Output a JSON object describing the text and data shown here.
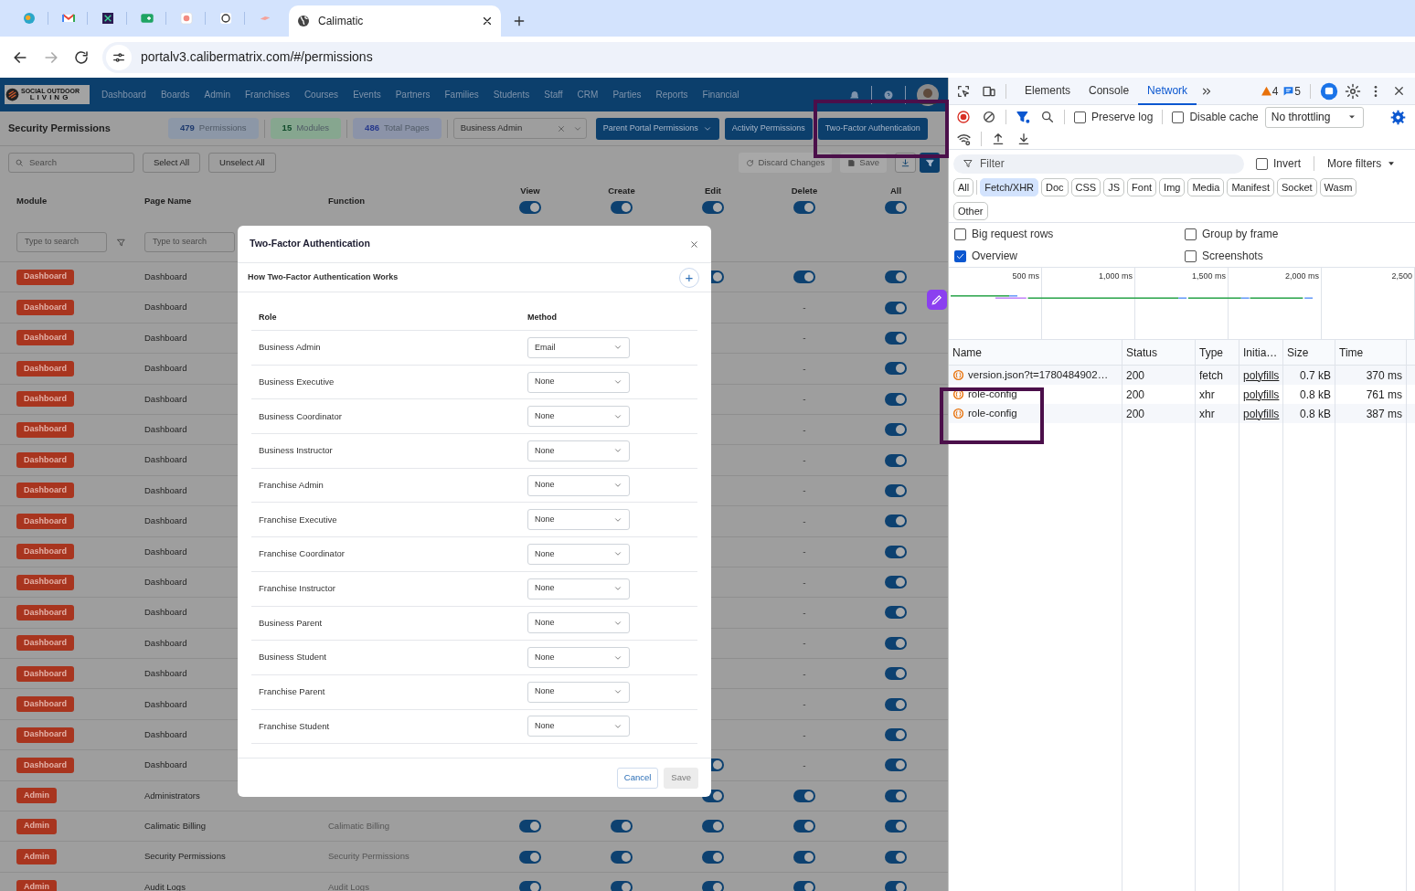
{
  "browser": {
    "active_tab": {
      "title": "Calimatic"
    },
    "url": "portalv3.calibermatrix.com/#/permissions",
    "forward_disabled": true
  },
  "app": {
    "logo": [
      "SOCIAL OUTDOOR",
      "LIVING"
    ],
    "nav": [
      "Dashboard",
      "Boards",
      "Admin",
      "Franchises",
      "Courses",
      "Events",
      "Partners",
      "Families",
      "Students",
      "Staff",
      "CRM",
      "Parties",
      "Reports",
      "Financial"
    ],
    "title": "Security Permissions",
    "stats": [
      {
        "count": "479",
        "label": "Permissions",
        "kind": "blue"
      },
      {
        "count": "15",
        "label": "Modules",
        "kind": "green"
      },
      {
        "count": "486",
        "label": "Total Pages",
        "kind": "indigo"
      }
    ],
    "role_select": {
      "value": "Business Admin"
    },
    "header_buttons": [
      {
        "label": "Parent Portal Permissions",
        "dropdown": true
      },
      {
        "label": "Activity Permissions",
        "dropdown": false
      },
      {
        "label": "Two-Factor Authentication",
        "dropdown": false
      }
    ],
    "search": {
      "placeholder": "Search"
    },
    "select_buttons": [
      "Select All",
      "Unselect All"
    ],
    "discard": {
      "label": "Discard Changes",
      "disabled": true
    },
    "save": {
      "label": "Save",
      "disabled": true
    },
    "columns": [
      "Module",
      "Page Name",
      "Function"
    ],
    "perm_columns": [
      {
        "label": "View",
        "on": true
      },
      {
        "label": "Create",
        "on": true
      },
      {
        "label": "Edit",
        "on": true
      },
      {
        "label": "Delete",
        "on": true
      },
      {
        "label": "All",
        "on": true
      }
    ],
    "filter_placeholders": [
      "Type to search",
      "Type to search"
    ],
    "rows": [
      {
        "module": "Dashboard",
        "page": "Dashboard",
        "perms": {
          "edit": {
            "kind": "toggle",
            "on": true
          },
          "delete": {
            "kind": "toggle",
            "on": true
          },
          "all": {
            "kind": "toggle",
            "on": true
          }
        }
      },
      {
        "module": "Dashboard",
        "page": "Dashboard",
        "perms": {
          "delete": {
            "kind": "dash",
            "text": "-"
          },
          "all": {
            "kind": "toggle",
            "on": true
          }
        }
      },
      {
        "module": "Dashboard",
        "page": "Dashboard",
        "perms": {
          "delete": {
            "kind": "dash",
            "text": "-"
          },
          "all": {
            "kind": "toggle",
            "on": true
          }
        }
      },
      {
        "module": "Dashboard",
        "page": "Dashboard",
        "perms": {
          "delete": {
            "kind": "dash",
            "text": "-"
          },
          "all": {
            "kind": "toggle",
            "on": true
          }
        }
      },
      {
        "module": "Dashboard",
        "page": "Dashboard",
        "perms": {
          "delete": {
            "kind": "dash",
            "text": "-"
          },
          "all": {
            "kind": "toggle",
            "on": true
          }
        }
      },
      {
        "module": "Dashboard",
        "page": "Dashboard",
        "perms": {
          "delete": {
            "kind": "dash",
            "text": "-"
          },
          "all": {
            "kind": "toggle",
            "on": true
          }
        }
      },
      {
        "module": "Dashboard",
        "page": "Dashboard",
        "perms": {
          "delete": {
            "kind": "dash",
            "text": "-"
          },
          "all": {
            "kind": "toggle",
            "on": true
          }
        }
      },
      {
        "module": "Dashboard",
        "page": "Dashboard",
        "perms": {
          "delete": {
            "kind": "dash",
            "text": "-"
          },
          "all": {
            "kind": "toggle",
            "on": true
          }
        }
      },
      {
        "module": "Dashboard",
        "page": "Dashboard",
        "perms": {
          "delete": {
            "kind": "dash",
            "text": "-"
          },
          "all": {
            "kind": "toggle",
            "on": true
          }
        }
      },
      {
        "module": "Dashboard",
        "page": "Dashboard",
        "perms": {
          "delete": {
            "kind": "dash",
            "text": "-"
          },
          "all": {
            "kind": "toggle",
            "on": true
          }
        }
      },
      {
        "module": "Dashboard",
        "page": "Dashboard",
        "perms": {
          "delete": {
            "kind": "dash",
            "text": "-"
          },
          "all": {
            "kind": "toggle",
            "on": true
          }
        }
      },
      {
        "module": "Dashboard",
        "page": "Dashboard",
        "perms": {
          "delete": {
            "kind": "dash",
            "text": "-"
          },
          "all": {
            "kind": "toggle",
            "on": true
          }
        }
      },
      {
        "module": "Dashboard",
        "page": "Dashboard",
        "perms": {
          "delete": {
            "kind": "dash",
            "text": "-"
          },
          "all": {
            "kind": "toggle",
            "on": true
          }
        }
      },
      {
        "module": "Dashboard",
        "page": "Dashboard",
        "perms": {
          "delete": {
            "kind": "dash",
            "text": "-"
          },
          "all": {
            "kind": "toggle",
            "on": true
          }
        }
      },
      {
        "module": "Dashboard",
        "page": "Dashboard",
        "perms": {
          "delete": {
            "kind": "dash",
            "text": "-"
          },
          "all": {
            "kind": "toggle",
            "on": true
          }
        }
      },
      {
        "module": "Dashboard",
        "page": "Dashboard",
        "perms": {
          "delete": {
            "kind": "dash",
            "text": "-"
          },
          "all": {
            "kind": "toggle",
            "on": true
          }
        }
      },
      {
        "module": "Dashboard",
        "page": "Dashboard",
        "perms": {
          "edit": {
            "kind": "toggle",
            "on": true
          },
          "delete": {
            "kind": "dash",
            "text": "-"
          },
          "all": {
            "kind": "toggle",
            "on": true
          }
        }
      },
      {
        "module": "Admin",
        "page": "Administrators",
        "perms": {
          "edit": {
            "kind": "toggle",
            "on": true
          },
          "delete": {
            "kind": "toggle",
            "on": true
          },
          "all": {
            "kind": "toggle",
            "on": true
          }
        }
      },
      {
        "module": "Admin",
        "page": "Calimatic Billing",
        "function": "Calimatic Billing",
        "perms": {
          "view": {
            "kind": "toggle",
            "on": true
          },
          "create": {
            "kind": "toggle",
            "on": true
          },
          "edit": {
            "kind": "toggle",
            "on": true
          },
          "delete": {
            "kind": "toggle",
            "on": true
          },
          "all": {
            "kind": "toggle",
            "on": true
          }
        }
      },
      {
        "module": "Admin",
        "page": "Security Permissions",
        "function": "Security Permissions",
        "perms": {
          "view": {
            "kind": "toggle",
            "on": true
          },
          "create": {
            "kind": "toggle",
            "on": true
          },
          "edit": {
            "kind": "toggle",
            "on": true
          },
          "delete": {
            "kind": "toggle",
            "on": true
          },
          "all": {
            "kind": "toggle",
            "on": true
          }
        }
      },
      {
        "module": "Admin",
        "page": "Audit Logs",
        "function": "Audit Logs",
        "perms": {
          "view": {
            "kind": "toggle",
            "on": true
          },
          "create": {
            "kind": "toggle",
            "on": true
          },
          "edit": {
            "kind": "toggle",
            "on": true
          },
          "delete": {
            "kind": "toggle",
            "on": true
          },
          "all": {
            "kind": "toggle",
            "on": true
          }
        }
      }
    ]
  },
  "modal": {
    "title": "Two-Factor Authentication",
    "section_title": "How Two-Factor Authentication Works",
    "expand_symbol": "+",
    "columns": [
      "Role",
      "Method"
    ],
    "rows": [
      {
        "role": "Business Admin",
        "method": "Email"
      },
      {
        "role": "Business Executive",
        "method": "None"
      },
      {
        "role": "Business Coordinator",
        "method": "None"
      },
      {
        "role": "Business Instructor",
        "method": "None"
      },
      {
        "role": "Franchise Admin",
        "method": "None"
      },
      {
        "role": "Franchise Executive",
        "method": "None"
      },
      {
        "role": "Franchise Coordinator",
        "method": "None"
      },
      {
        "role": "Franchise Instructor",
        "method": "None"
      },
      {
        "role": "Business Parent",
        "method": "None"
      },
      {
        "role": "Business Student",
        "method": "None"
      },
      {
        "role": "Franchise Parent",
        "method": "None"
      },
      {
        "role": "Franchise Student",
        "method": "None"
      }
    ],
    "cancel": "Cancel",
    "save": {
      "label": "Save",
      "disabled": true
    }
  },
  "devtools": {
    "tabs": [
      {
        "label": "Elements",
        "selected": false
      },
      {
        "label": "Console",
        "selected": false
      },
      {
        "label": "Network",
        "selected": true
      }
    ],
    "warnings": "4",
    "messages": "5",
    "toolbar_checks": [
      {
        "label": "Preserve log",
        "checked": false
      },
      {
        "label": "Disable cache",
        "checked": false
      }
    ],
    "throttling": "No throttling",
    "filter_placeholder": "Filter",
    "invert": {
      "label": "Invert",
      "checked": false
    },
    "more_filters": "More filters",
    "type_filters": [
      {
        "label": "All",
        "selected": false
      },
      {
        "label": "Fetch/XHR",
        "selected": true
      },
      {
        "label": "Doc",
        "selected": false
      },
      {
        "label": "CSS",
        "selected": false
      },
      {
        "label": "JS",
        "selected": false
      },
      {
        "label": "Font",
        "selected": false
      },
      {
        "label": "Img",
        "selected": false
      },
      {
        "label": "Media",
        "selected": false
      },
      {
        "label": "Manifest",
        "selected": false
      },
      {
        "label": "Socket",
        "selected": false
      },
      {
        "label": "Wasm",
        "selected": false
      },
      {
        "label": "Other",
        "selected": false
      }
    ],
    "options": [
      {
        "label": "Big request rows",
        "checked": false
      },
      {
        "label": "Group by frame",
        "checked": false
      },
      {
        "label": "Overview",
        "checked": true
      },
      {
        "label": "Screenshots",
        "checked": false
      }
    ],
    "timeline_ticks": [
      "500 ms",
      "1,000 ms",
      "1,500 ms",
      "2,000 ms",
      "2,500"
    ],
    "columns": [
      "Name",
      "Status",
      "Type",
      "Initia…",
      "Size",
      "Time"
    ],
    "requests": [
      {
        "name": "version.json?t=1780484902…",
        "status": "200",
        "type": "fetch",
        "initiator": "polyfills",
        "size": "0.7 kB",
        "time": "370 ms"
      },
      {
        "name": "role-config",
        "status": "200",
        "type": "xhr",
        "initiator": "polyfills",
        "size": "0.8 kB",
        "time": "761 ms"
      },
      {
        "name": "role-config",
        "status": "200",
        "type": "xhr",
        "initiator": "polyfills",
        "size": "0.8 kB",
        "time": "387 ms"
      }
    ]
  }
}
